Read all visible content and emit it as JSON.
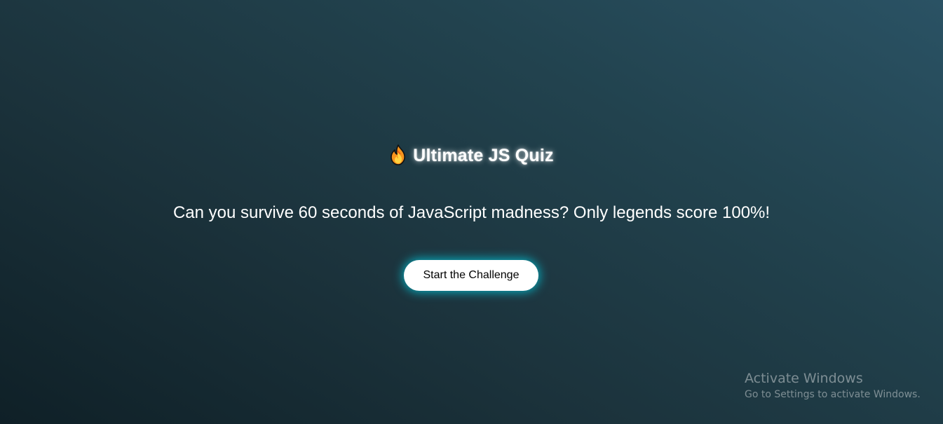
{
  "quiz": {
    "title": "Ultimate JS Quiz",
    "title_icon": "fire-icon",
    "tagline": "Can you survive 60 seconds of JavaScript madness? Only legends score 100%!",
    "start_button_label": "Start the Challenge"
  },
  "os_watermark": {
    "title": "Activate Windows",
    "subtitle": "Go to Settings to activate Windows."
  },
  "colors": {
    "background_dark": "#0f2027",
    "background_light": "#2a5264",
    "button_glow": "#00d2e6",
    "text": "#ffffff"
  }
}
